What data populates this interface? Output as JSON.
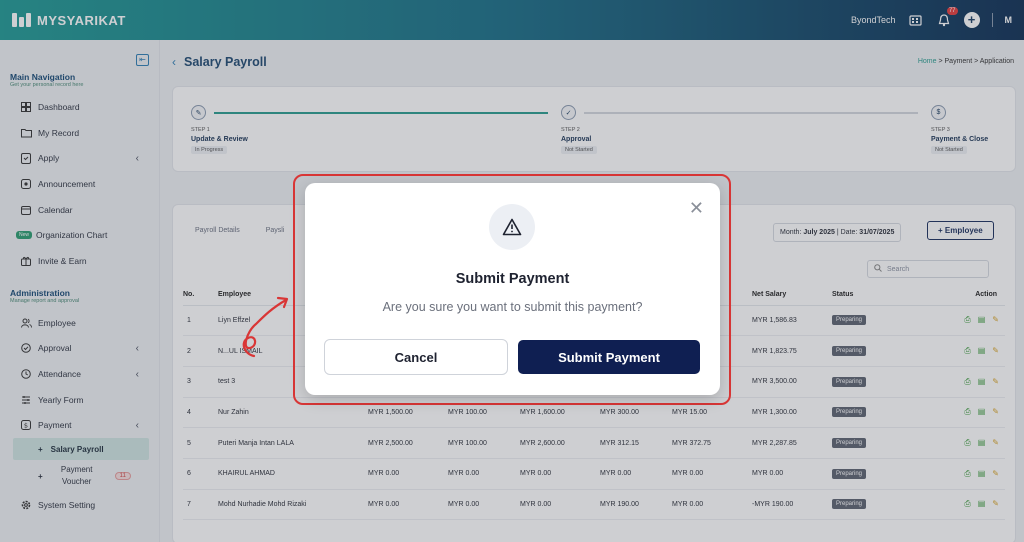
{
  "app": {
    "name": "MYSYARIKAT",
    "company": "ByondTech",
    "notif_count": "77",
    "user_initial": "M"
  },
  "sidebar": {
    "main_title": "Main Navigation",
    "main_sub": "Get your personal record here",
    "main_items": [
      {
        "label": "Dashboard",
        "icon": "grid-icon"
      },
      {
        "label": "My Record",
        "icon": "folder-icon"
      },
      {
        "label": "Apply",
        "icon": "apply-icon"
      },
      {
        "label": "Announcement",
        "icon": "announcement-icon"
      },
      {
        "label": "Calendar",
        "icon": "calendar-icon"
      },
      {
        "label": "Organization Chart",
        "badge": "New"
      },
      {
        "label": "Invite & Earn",
        "icon": "gift-icon"
      }
    ],
    "admin_title": "Administration",
    "admin_sub": "Manage report and approval",
    "admin_items": [
      {
        "label": "Employee"
      },
      {
        "label": "Approval"
      },
      {
        "label": "Attendance"
      },
      {
        "label": "Yearly Form"
      },
      {
        "label": "Payment"
      }
    ],
    "payment_sub": {
      "salary": "Salary Payroll",
      "voucher": "Payment Voucher",
      "voucher_count": "11"
    },
    "system": "System Setting"
  },
  "page": {
    "title": "Salary Payroll",
    "breadcrumb": {
      "home": "Home",
      "sep": ">",
      "b2": "Payment",
      "b3": "Application"
    }
  },
  "steps": [
    {
      "label": "STEP 1",
      "name": "Update & Review",
      "status": "In Progress"
    },
    {
      "label": "STEP 2",
      "name": "Approval",
      "status": "Not Started"
    },
    {
      "label": "STEP 3",
      "name": "Payment & Close",
      "status": "Not Started"
    }
  ],
  "tabs": [
    "Payroll Details",
    "Paysli"
  ],
  "month_filter": {
    "month_label": "Month:",
    "month": "July 2025",
    "date_label": "| Date:",
    "date": "31/07/2025"
  },
  "add_employee": "+ Employee",
  "search_placeholder": "Search",
  "table": {
    "headers": [
      "No.",
      "Employee",
      "",
      "",
      "",
      "",
      "ction",
      "Net Salary",
      "Status",
      "Action"
    ],
    "rows": [
      {
        "no": "1",
        "name": "Liyn Effzel",
        "c1": "",
        "c2": "",
        "c3": "",
        "c4": "",
        "c5": "",
        "net": "MYR 1,586.83",
        "status": "Preparing"
      },
      {
        "no": "2",
        "name": "N...UL ISMAIL",
        "c1": "",
        "c2": "",
        "c3": "",
        "c4": "",
        "c5": "",
        "net": "MYR 1,823.75",
        "status": "Preparing"
      },
      {
        "no": "3",
        "name": "test 3",
        "c1": "",
        "c2": "",
        "c3": "",
        "c4": "",
        "c5": "",
        "net": "MYR 3,500.00",
        "status": "Preparing"
      },
      {
        "no": "4",
        "name": "Nur Zahin",
        "c1": "MYR 1,500.00",
        "c2": "MYR 100.00",
        "c3": "MYR 1,600.00",
        "c4": "MYR 300.00",
        "c5": "MYR 15.00",
        "net": "MYR 1,300.00",
        "status": "Preparing"
      },
      {
        "no": "5",
        "name": "Puteri Manja Intan LALA",
        "c1": "MYR 2,500.00",
        "c2": "MYR 100.00",
        "c3": "MYR 2,600.00",
        "c4": "MYR 312.15",
        "c5": "MYR 372.75",
        "net": "MYR 2,287.85",
        "status": "Preparing"
      },
      {
        "no": "6",
        "name": "KHAIRUL AHMAD",
        "c1": "MYR 0.00",
        "c2": "MYR 0.00",
        "c3": "MYR 0.00",
        "c4": "MYR 0.00",
        "c5": "MYR 0.00",
        "net": "MYR 0.00",
        "status": "Preparing"
      },
      {
        "no": "7",
        "name": "Mohd Nurhadie Mohd Rizaki",
        "c1": "MYR 0.00",
        "c2": "MYR 0.00",
        "c3": "MYR 0.00",
        "c4": "MYR 190.00",
        "c5": "MYR 0.00",
        "net": "-MYR 190.00",
        "status": "Preparing"
      }
    ]
  },
  "modal": {
    "title": "Submit Payment",
    "message": "Are you sure you want to submit this payment?",
    "cancel": "Cancel",
    "submit": "Submit Payment"
  },
  "colors": {
    "accent": "#2a9d8f",
    "primary": "#0f1f52",
    "highlight": "#d93636"
  }
}
